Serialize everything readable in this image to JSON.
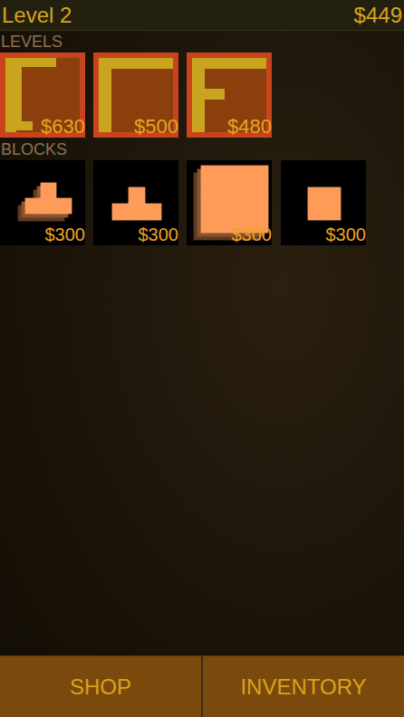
{
  "header": {
    "title": "Level 2",
    "money": "$449"
  },
  "levels": {
    "label": "LEVELS",
    "items": [
      {
        "kind": "bracket",
        "price": "$630"
      },
      {
        "kind": "corner",
        "price": "$500"
      },
      {
        "kind": "eff",
        "price": "$480"
      }
    ]
  },
  "blocks": {
    "label": "BLOCKS",
    "items": [
      {
        "kind": "stackedtee",
        "price": "$300"
      },
      {
        "kind": "tee",
        "price": "$300"
      },
      {
        "kind": "bigsquare",
        "price": "$300"
      },
      {
        "kind": "square",
        "price": "$300"
      }
    ]
  },
  "buttons": [
    "SHOP",
    "INVENTORY"
  ]
}
